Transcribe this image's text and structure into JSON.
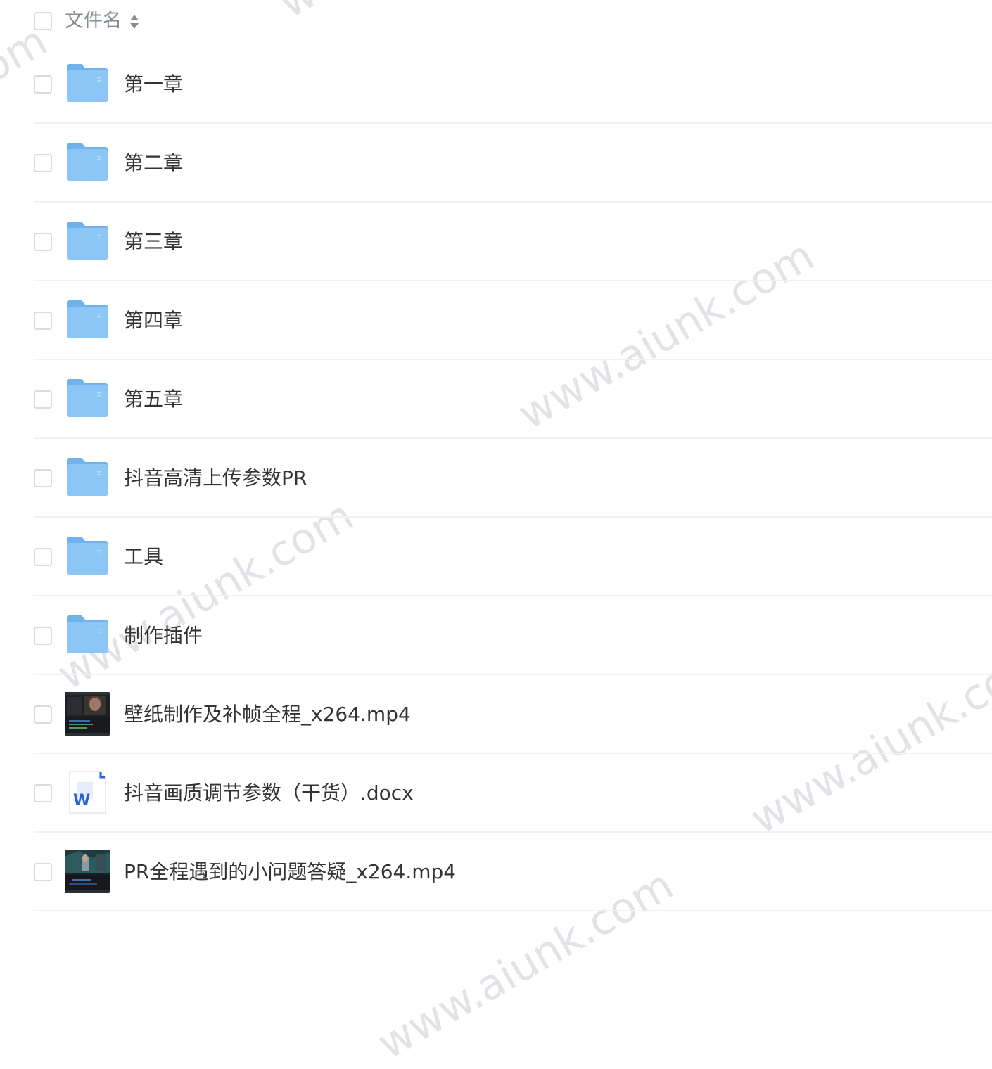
{
  "header": {
    "filename_label": "文件名"
  },
  "files": [
    {
      "name": "第一章",
      "type": "folder",
      "icon": "folder-icon"
    },
    {
      "name": "第二章",
      "type": "folder",
      "icon": "folder-icon"
    },
    {
      "name": "第三章",
      "type": "folder",
      "icon": "folder-icon"
    },
    {
      "name": "第四章",
      "type": "folder",
      "icon": "folder-icon"
    },
    {
      "name": "第五章",
      "type": "folder",
      "icon": "folder-icon"
    },
    {
      "name": "抖音高清上传参数PR",
      "type": "folder",
      "icon": "folder-icon"
    },
    {
      "name": "工具",
      "type": "folder",
      "icon": "folder-icon"
    },
    {
      "name": "制作插件",
      "type": "folder",
      "icon": "folder-icon"
    },
    {
      "name": "壁纸制作及补帧全程_x264.mp4",
      "type": "video",
      "icon": "video-thumbnail"
    },
    {
      "name": "抖音画质调节参数（干货）.docx",
      "type": "docx",
      "icon": "word-doc-icon",
      "icon_letter": "W"
    },
    {
      "name": "PR全程遇到的小问题答疑_x264.mp4",
      "type": "video",
      "icon": "video-thumbnail"
    }
  ],
  "watermark": "www.aiunk.com",
  "colors": {
    "folder": "#8cc6f6",
    "folder_tab": "#6fb2ee",
    "word_blue": "#2a63d6",
    "text": "#333333",
    "header_text": "#878c93",
    "divider": "#f1f2f4",
    "checkbox_border": "#d9dbdf"
  }
}
